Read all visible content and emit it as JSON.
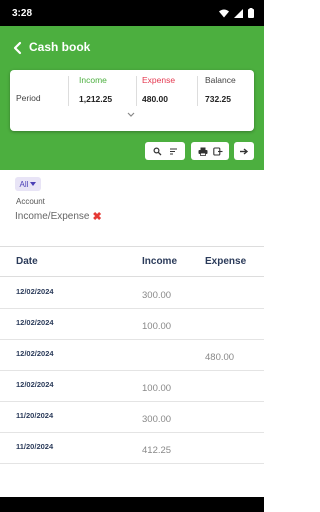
{
  "status_bar": {
    "time": "3:28",
    "icons": [
      "wifi-icon",
      "signal-icon",
      "battery-icon"
    ]
  },
  "header": {
    "title": "Cash book",
    "color": "#4caf3f"
  },
  "summary": {
    "period_label": "Period",
    "income": {
      "label": "Income",
      "value": "1,212.25",
      "color": "#4caf3f"
    },
    "expense": {
      "label": "Expense",
      "value": "480.00",
      "color": "#e53950"
    },
    "balance": {
      "label": "Balance",
      "value": "732.25",
      "color": "#444444"
    }
  },
  "toolbar": {
    "icons": [
      "search-icon",
      "sort-icon",
      "print-icon",
      "export-icon",
      "next-icon"
    ]
  },
  "filter": {
    "chip_label": "All"
  },
  "account": {
    "label": "Account",
    "value": "Income/Expense"
  },
  "table": {
    "headers": {
      "date": "Date",
      "income": "Income",
      "expense": "Expense"
    },
    "rows": [
      {
        "date": "12/02/2024",
        "income": "300.00",
        "expense": ""
      },
      {
        "date": "12/02/2024",
        "income": "100.00",
        "expense": ""
      },
      {
        "date": "12/02/2024",
        "income": "",
        "expense": "480.00"
      },
      {
        "date": "12/02/2024",
        "income": "100.00",
        "expense": ""
      },
      {
        "date": "11/20/2024",
        "income": "300.00",
        "expense": ""
      },
      {
        "date": "11/20/2024",
        "income": "412.25",
        "expense": ""
      }
    ]
  }
}
